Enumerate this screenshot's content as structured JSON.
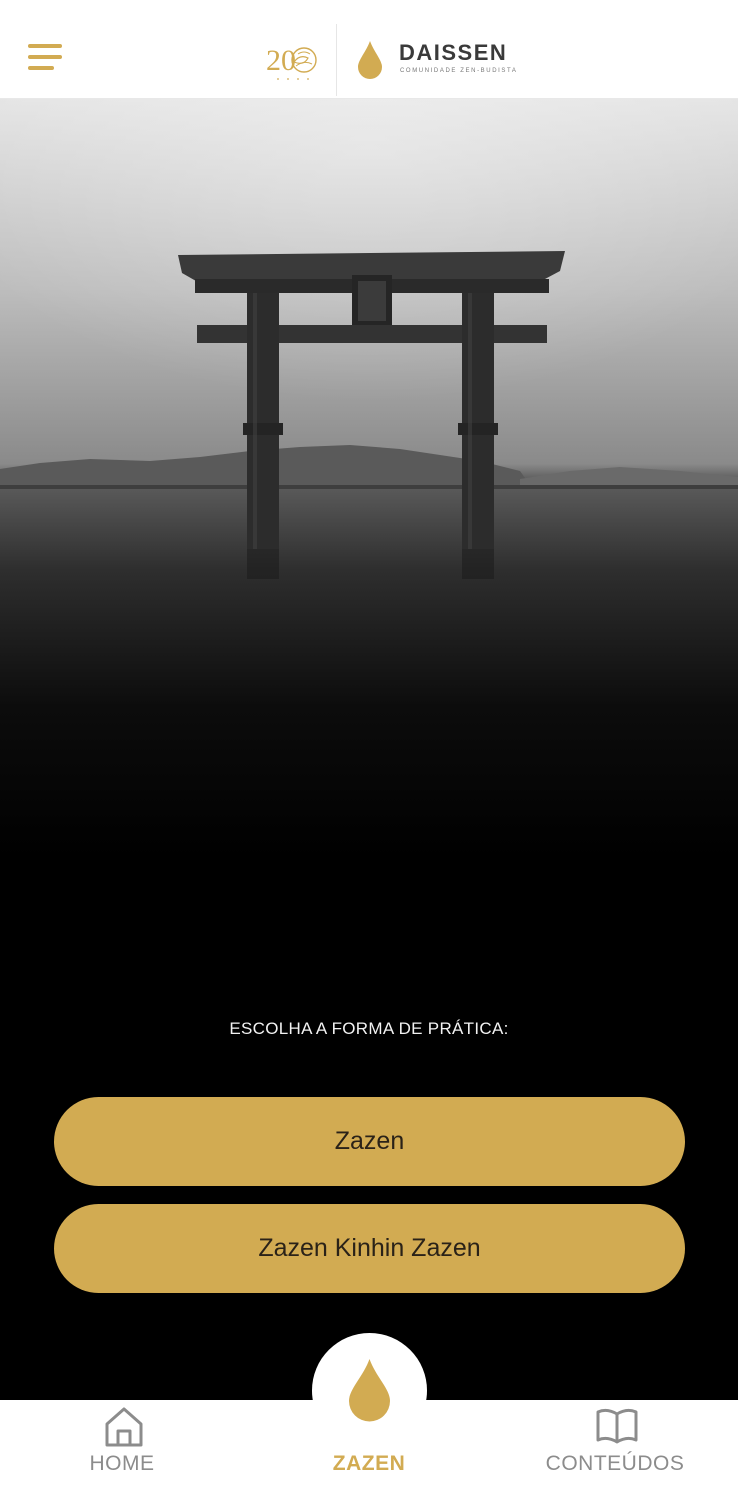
{
  "header": {
    "brand_name": "DAISSEN",
    "brand_tagline": "COMUNIDADE ZEN-BUDISTA",
    "anniversary_mark": "20"
  },
  "main": {
    "prompt": "ESCOLHA A FORMA DE PRÁTICA:",
    "options": [
      {
        "label": "Zazen"
      },
      {
        "label": "Zazen Kinhin Zazen"
      }
    ]
  },
  "bottom_nav": {
    "items": [
      {
        "label": "HOME",
        "icon": "home-icon",
        "active": false
      },
      {
        "label": "ZAZEN",
        "icon": "drop-icon",
        "active": true
      },
      {
        "label": "CONTEÚDOS",
        "icon": "book-icon",
        "active": false
      }
    ]
  },
  "colors": {
    "accent": "#d2ab52",
    "background": "#000000",
    "nav_inactive": "#8c8c8c"
  }
}
